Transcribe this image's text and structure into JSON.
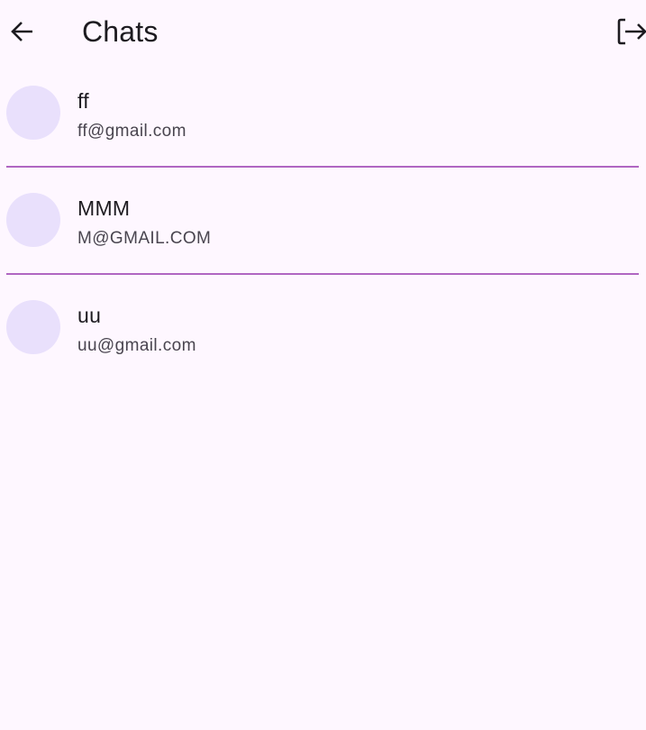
{
  "app_bar": {
    "title": "Chats",
    "back_icon": "arrow-left-icon",
    "logout_icon": "logout-icon"
  },
  "chats": [
    {
      "name": "ff",
      "email": "ff@gmail.com"
    },
    {
      "name": "MMM",
      "email": "M@GMAIL.COM"
    },
    {
      "name": "uu",
      "email": "uu@gmail.com"
    }
  ],
  "colors": {
    "background": "#fef7ff",
    "avatar": "#e9e0fc",
    "divider": "#b066c2",
    "primary_text": "#1d1b20",
    "secondary_text": "#49454f"
  }
}
